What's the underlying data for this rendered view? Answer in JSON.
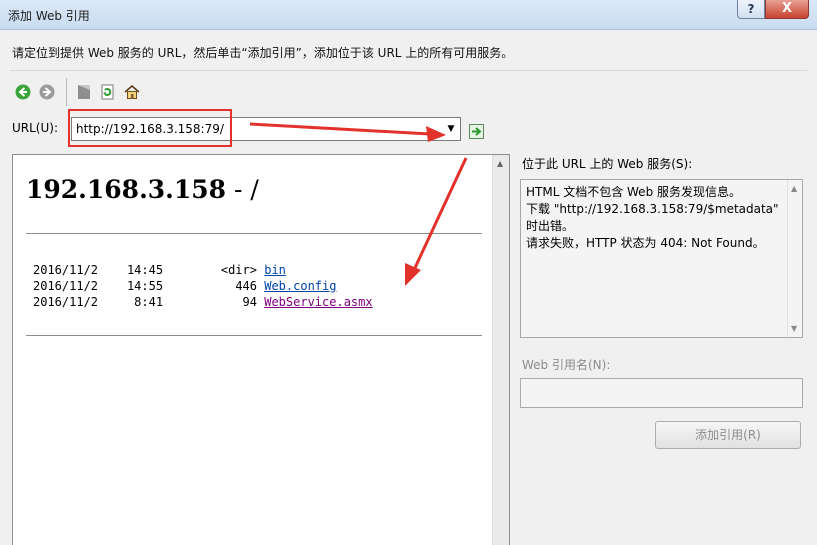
{
  "window": {
    "title": "添加 Web 引用",
    "help_label": "?",
    "close_label": "X"
  },
  "instruction": "请定位到提供 Web 服务的 URL，然后单击“添加引用”，添加位于该 URL 上的所有可用服务。",
  "url": {
    "label": "URL(U):",
    "value": "http://192.168.3.158:79/"
  },
  "browser": {
    "heading": "192.168.3.158",
    "heading_suffix": " - /",
    "rows": [
      {
        "date": "2016/11/2",
        "time": "14:45",
        "size": "<dir>",
        "name": "bin"
      },
      {
        "date": "2016/11/2",
        "time": "14:55",
        "size": "446",
        "name": "Web.config"
      },
      {
        "date": "2016/11/2",
        "time": "8:41",
        "size": "94",
        "name": "WebService.asmx"
      }
    ]
  },
  "services": {
    "label": "位于此 URL 上的 Web 服务(S):",
    "lines": [
      "HTML 文档不包含 Web 服务发现信息。",
      "下载 \"http://192.168.3.158:79/$metadata\"",
      "时出错。",
      "请求失败，HTTP 状态为 404: Not Found。"
    ]
  },
  "ref_name": {
    "label": "Web 引用名(N):",
    "value": ""
  },
  "add_button": "添加引用(R)",
  "colors": {
    "annotation": "#e3312c",
    "link": "#0044aa",
    "visited_link": "#800080"
  }
}
